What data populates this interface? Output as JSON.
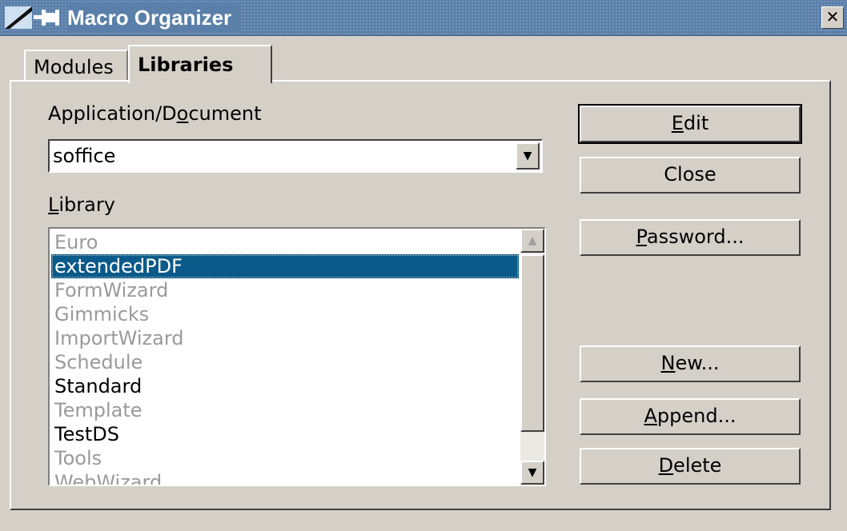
{
  "window": {
    "title": "Macro Organizer",
    "close_glyph": "✕"
  },
  "tabs": [
    {
      "label": "Modules",
      "active": false
    },
    {
      "label": "Libraries",
      "active": true
    }
  ],
  "app_doc": {
    "label_pre": "Application/D",
    "label_u": "o",
    "label_post": "cument",
    "value": "soffice"
  },
  "library": {
    "label_u": "L",
    "label_post": "ibrary",
    "items": [
      {
        "label": "Euro",
        "enabled": false,
        "selected": false
      },
      {
        "label": "extendedPDF",
        "enabled": true,
        "selected": true
      },
      {
        "label": "FormWizard",
        "enabled": false,
        "selected": false
      },
      {
        "label": "Gimmicks",
        "enabled": false,
        "selected": false
      },
      {
        "label": "ImportWizard",
        "enabled": false,
        "selected": false
      },
      {
        "label": "Schedule",
        "enabled": false,
        "selected": false
      },
      {
        "label": "Standard",
        "enabled": true,
        "selected": false
      },
      {
        "label": "Template",
        "enabled": false,
        "selected": false
      },
      {
        "label": "TestDS",
        "enabled": true,
        "selected": false
      },
      {
        "label": "Tools",
        "enabled": false,
        "selected": false
      },
      {
        "label": "WebWizard",
        "enabled": false,
        "selected": false
      }
    ]
  },
  "buttons": {
    "edit": {
      "u": "E",
      "rest": "dit"
    },
    "close": {
      "label": "Close"
    },
    "password": {
      "u": "P",
      "rest": "assword..."
    },
    "new": {
      "u": "N",
      "rest": "ew..."
    },
    "append": {
      "u": "A",
      "rest": "ppend..."
    },
    "delete": {
      "u": "D",
      "rest": "elete"
    }
  },
  "icons": {
    "window_icon": "macro-pin-icon",
    "dropdown": "chevron-down-icon",
    "scroll_up": "chevron-up-icon",
    "scroll_down": "chevron-down-icon"
  },
  "colors": {
    "titlebar": "#5a7fa8",
    "selection": "#0a5a8a",
    "disabled_text": "#9a9a9a"
  }
}
